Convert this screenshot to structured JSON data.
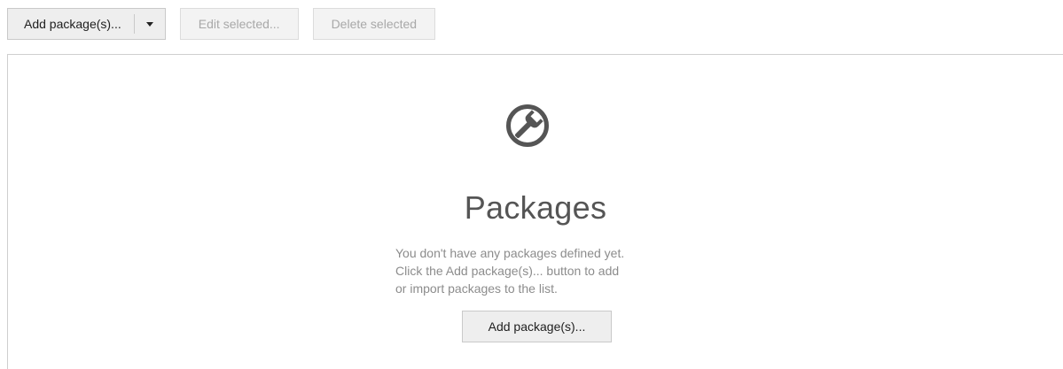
{
  "toolbar": {
    "add_label": "Add package(s)...",
    "edit_label": "Edit selected...",
    "delete_label": "Delete selected"
  },
  "empty_state": {
    "icon": "wrench-icon",
    "title": "Packages",
    "description_lines": [
      "You don't have any packages defined yet.",
      "Click the Add package(s)... button to add",
      "or import packages to the list."
    ],
    "button_label": "Add package(s)..."
  },
  "colors": {
    "icon": "#555555",
    "title": "#555555",
    "description": "#8c8c8c",
    "disabled_text": "#a8a8a8"
  }
}
